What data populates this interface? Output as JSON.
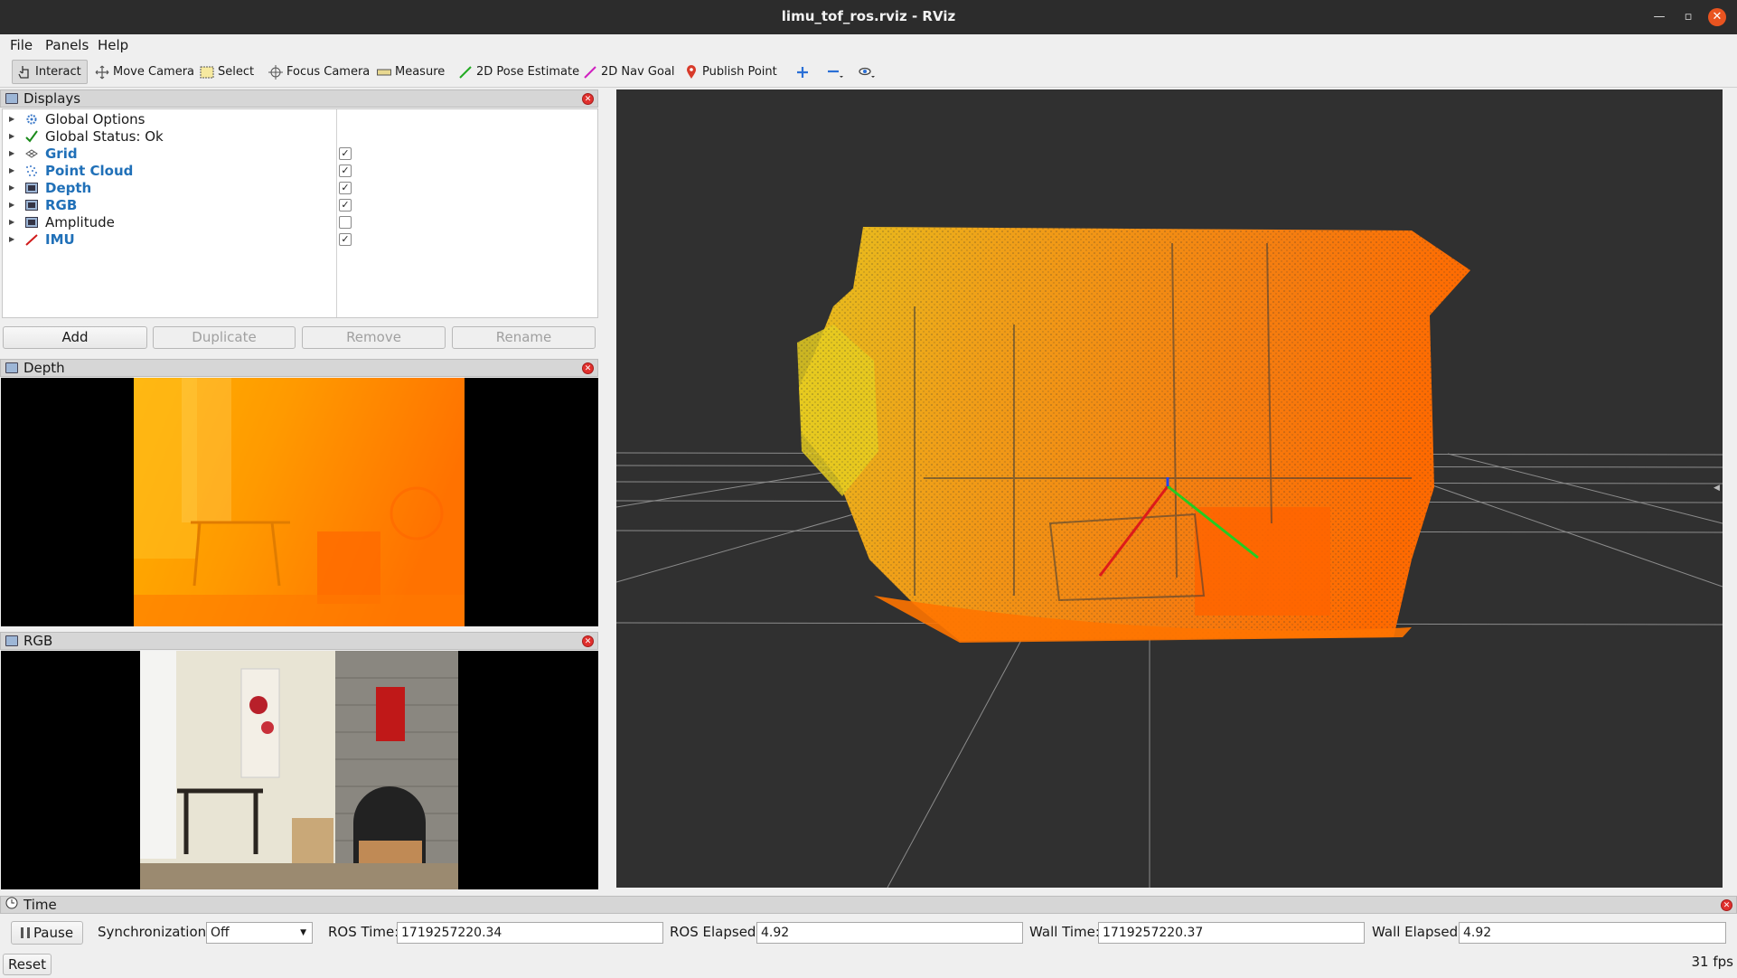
{
  "window": {
    "title": "limu_tof_ros.rviz - RViz"
  },
  "menubar": {
    "items": [
      "File",
      "Panels",
      "Help"
    ]
  },
  "toolbar": {
    "tools": [
      "Interact",
      "Move Camera",
      "Select",
      "Focus Camera",
      "Measure",
      "2D Pose Estimate",
      "2D Nav Goal",
      "Publish Point"
    ]
  },
  "displays": {
    "title": "Displays",
    "items": [
      {
        "label": "Global Options",
        "checked": null,
        "icon": "gear-icon"
      },
      {
        "label": "Global Status: Ok",
        "checked": null,
        "icon": "checkmark-icon"
      },
      {
        "label": "Grid",
        "checked": true,
        "icon": "grid-icon",
        "highlight": true
      },
      {
        "label": "Point Cloud",
        "checked": true,
        "icon": "point-cloud-icon",
        "highlight": true
      },
      {
        "label": "Depth",
        "checked": true,
        "icon": "image-icon",
        "highlight": true
      },
      {
        "label": "RGB",
        "checked": true,
        "icon": "image-icon",
        "highlight": true
      },
      {
        "label": "Amplitude",
        "checked": false,
        "icon": "image-icon",
        "highlight": false
      },
      {
        "label": "IMU",
        "checked": true,
        "icon": "axes-icon",
        "highlight": true
      }
    ],
    "buttons": {
      "add": "Add",
      "duplicate": "Duplicate",
      "remove": "Remove",
      "rename": "Rename"
    }
  },
  "depth_panel": {
    "title": "Depth"
  },
  "rgb_panel": {
    "title": "RGB"
  },
  "time_panel": {
    "title": "Time",
    "pause_label": "Pause",
    "sync_label": "Synchronization:",
    "sync_value": "Off",
    "ros_time_label": "ROS Time:",
    "ros_time": "1719257220.34",
    "ros_elapsed_label": "ROS Elapsed:",
    "ros_elapsed": "4.92",
    "wall_time_label": "Wall Time:",
    "wall_time": "1719257220.37",
    "wall_elapsed_label": "Wall Elapsed:",
    "wall_elapsed": "4.92",
    "reset_label": "Reset",
    "fps": "31 fps"
  },
  "colors": {
    "accent_blue": "#2070b8",
    "viewport_bg": "#303030",
    "cloud_near": "#ff6a00",
    "cloud_far": "#e8d020",
    "axis_x": "#dd1a1a",
    "axis_y": "#22cc22"
  }
}
